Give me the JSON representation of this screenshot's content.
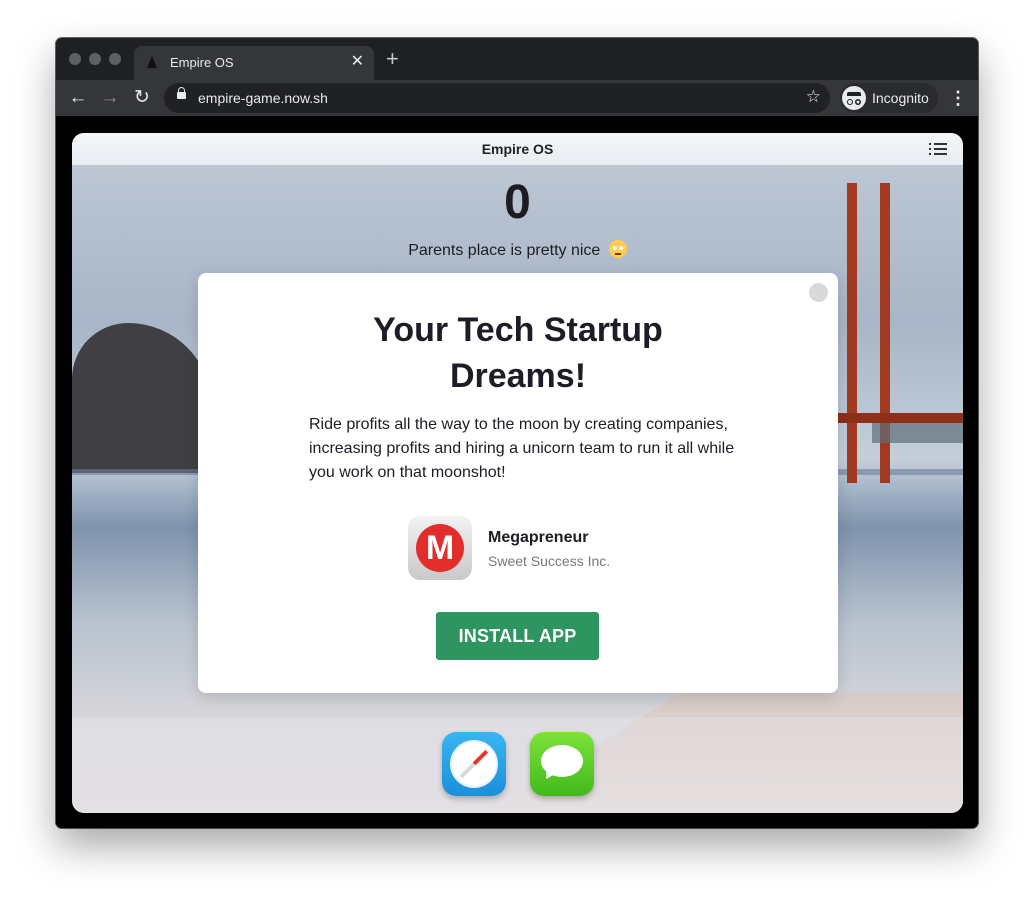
{
  "browser": {
    "tab_title": "Empire OS",
    "new_tab": "+",
    "tab_close": "✕",
    "url": "empire-game.now.sh",
    "incognito_label": "Incognito",
    "nav": {
      "back": "←",
      "forward": "→",
      "reload": "↻",
      "star": "☆",
      "menu": "⋮"
    }
  },
  "os": {
    "title": "Empire OS",
    "counter": "0",
    "status": "Parents place is pretty nice"
  },
  "modal": {
    "heading": "Your Tech Startup Dreams!",
    "body": "Ride profits all the way to the moon by creating companies, increasing profits and hiring a unicorn team to run it all while you work on that moonshot!",
    "app_name": "Megapreneur",
    "app_company": "Sweet Success Inc.",
    "app_icon_letter": "M",
    "install_label": "INSTALL APP"
  },
  "dock": {
    "apps": [
      "safari-icon",
      "messages-icon"
    ]
  },
  "colors": {
    "install": "#2f9560",
    "app_icon_red": "#e22d2d"
  }
}
